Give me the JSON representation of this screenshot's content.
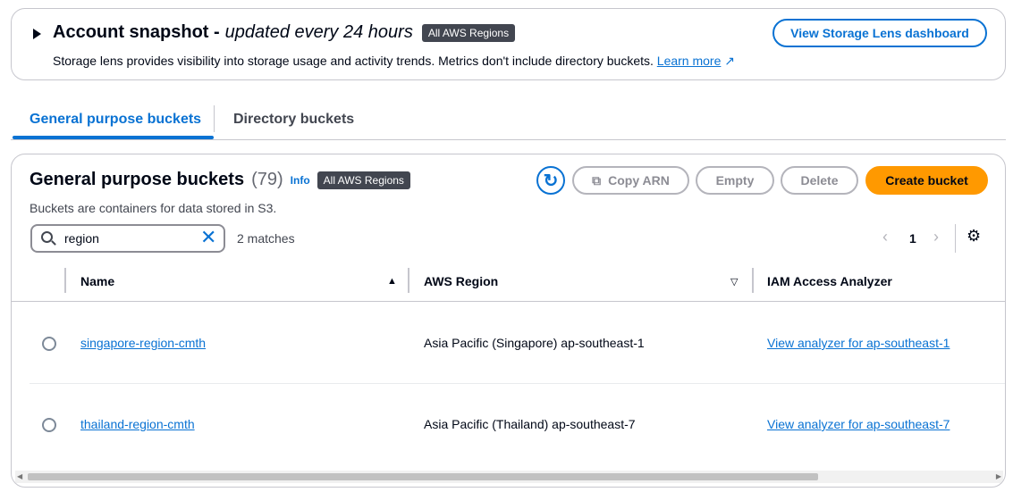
{
  "snapshot": {
    "title": "Account snapshot -",
    "subtitle_italic": "updated every 24 hours",
    "badge": "All AWS Regions",
    "description": "Storage lens provides visibility into storage usage and activity trends. Metrics don't include directory buckets.",
    "learn_more": "Learn more",
    "dashboard_button": "View Storage Lens dashboard"
  },
  "tabs": [
    {
      "label": "General purpose buckets",
      "active": true
    },
    {
      "label": "Directory buckets",
      "active": false
    }
  ],
  "panel": {
    "title": "General purpose buckets",
    "count": "(79)",
    "info": "Info",
    "badge": "All AWS Regions",
    "description": "Buckets are containers for data stored in S3.",
    "buttons": {
      "copy_arn": "Copy ARN",
      "empty": "Empty",
      "delete": "Delete",
      "create": "Create bucket"
    },
    "search": {
      "value": "region",
      "matches": "2 matches"
    },
    "pagination": {
      "page": "1"
    },
    "columns": [
      "Name",
      "AWS Region",
      "IAM Access Analyzer"
    ],
    "rows": [
      {
        "name": "singapore-region-cmth",
        "region": "Asia Pacific (Singapore) ap-southeast-1",
        "analyzer": "View analyzer for ap-southeast-1"
      },
      {
        "name": "thailand-region-cmth",
        "region": "Asia Pacific (Thailand) ap-southeast-7",
        "analyzer": "View analyzer for ap-southeast-7"
      }
    ]
  },
  "colors": {
    "accent": "#0972d3",
    "primary_button": "#ff9900",
    "badge": "#424650"
  }
}
